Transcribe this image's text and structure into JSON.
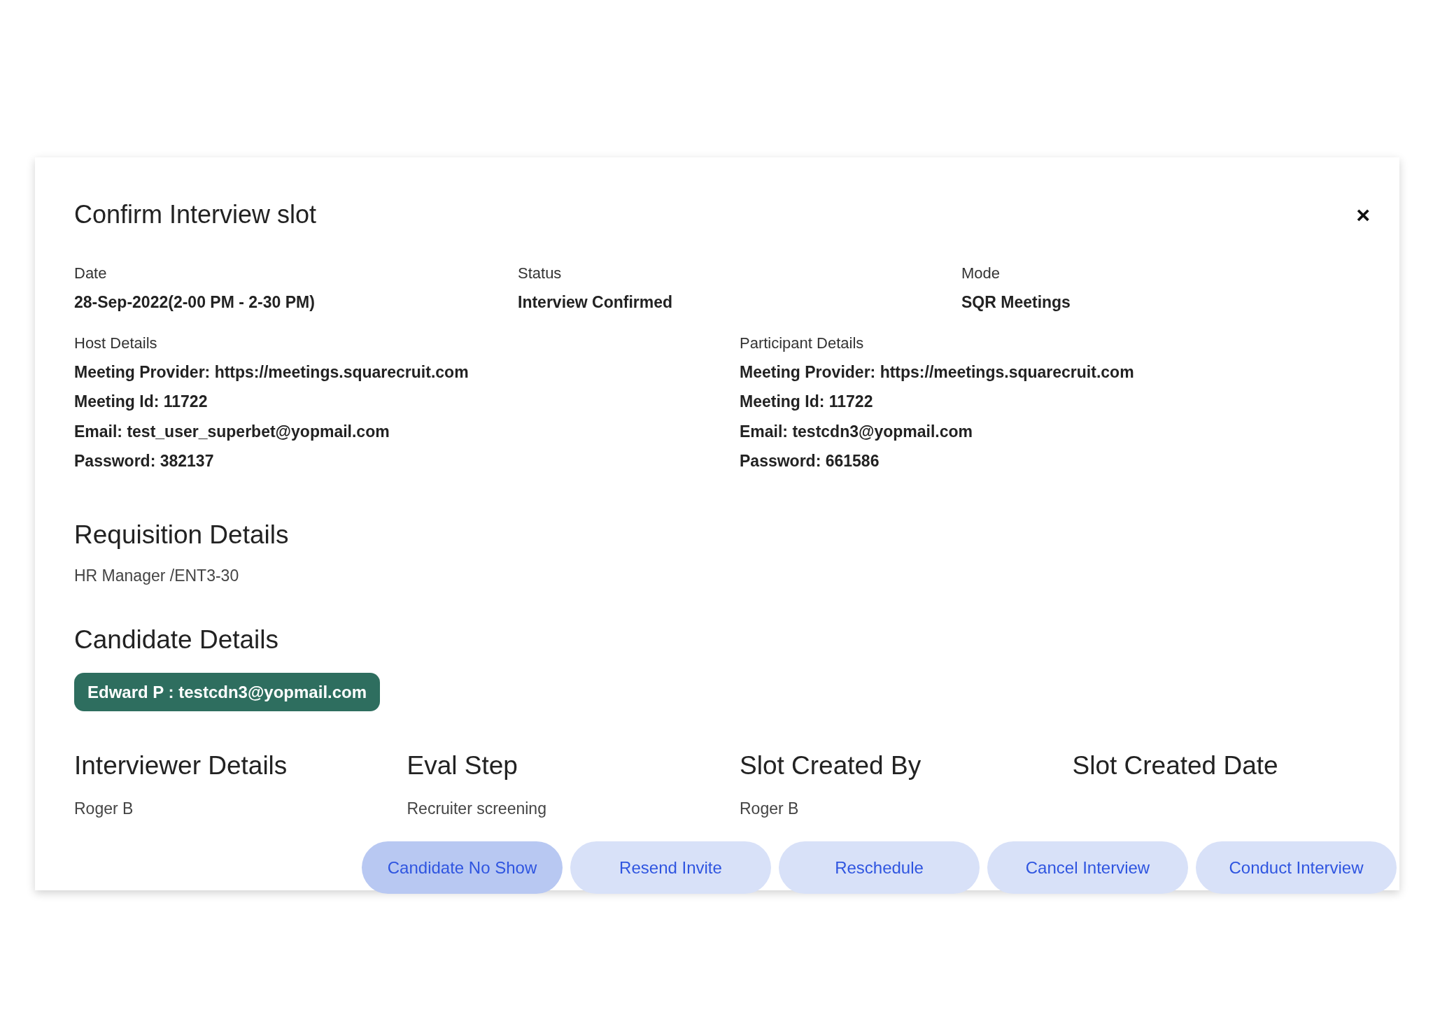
{
  "dialog": {
    "title": "Confirm Interview slot",
    "close": "×"
  },
  "summary": [
    {
      "label": "Date",
      "value": "28-Sep-2022(2-00 PM - 2-30 PM)"
    },
    {
      "label": "Status",
      "value": "Interview Confirmed"
    },
    {
      "label": "Mode",
      "value": "SQR Meetings"
    }
  ],
  "meeting_details": [
    {
      "label": "Host Details",
      "lines": [
        "Meeting Provider: https://meetings.squarecruit.com",
        "Meeting Id: 11722",
        "Email: test_user_superbet@yopmail.com",
        "Password: 382137"
      ]
    },
    {
      "label": "Participant Details",
      "lines": [
        "Meeting Provider: https://meetings.squarecruit.com",
        "Meeting Id: 11722",
        "Email: testcdn3@yopmail.com",
        "Password: 661586"
      ]
    }
  ],
  "requisition": {
    "heading": "Requisition Details",
    "value": "HR Manager /ENT3-30"
  },
  "candidate": {
    "heading": "Candidate Details",
    "chips": [
      "Edward P : testcdn3@yopmail.com"
    ]
  },
  "info_columns": [
    {
      "heading": "Interviewer Details",
      "value": "Roger B"
    },
    {
      "heading": "Eval Step",
      "value": "Recruiter screening"
    },
    {
      "heading": "Slot Created By",
      "value": "Roger B"
    },
    {
      "heading": "Slot Created Date"
    }
  ],
  "actions": [
    {
      "label": "Candidate No Show",
      "selected": true
    },
    {
      "label": "Resend Invite",
      "selected": false
    },
    {
      "label": "Reschedule",
      "selected": false
    },
    {
      "label": "Cancel Interview",
      "selected": false
    },
    {
      "label": "Conduct Interview",
      "selected": false
    }
  ]
}
